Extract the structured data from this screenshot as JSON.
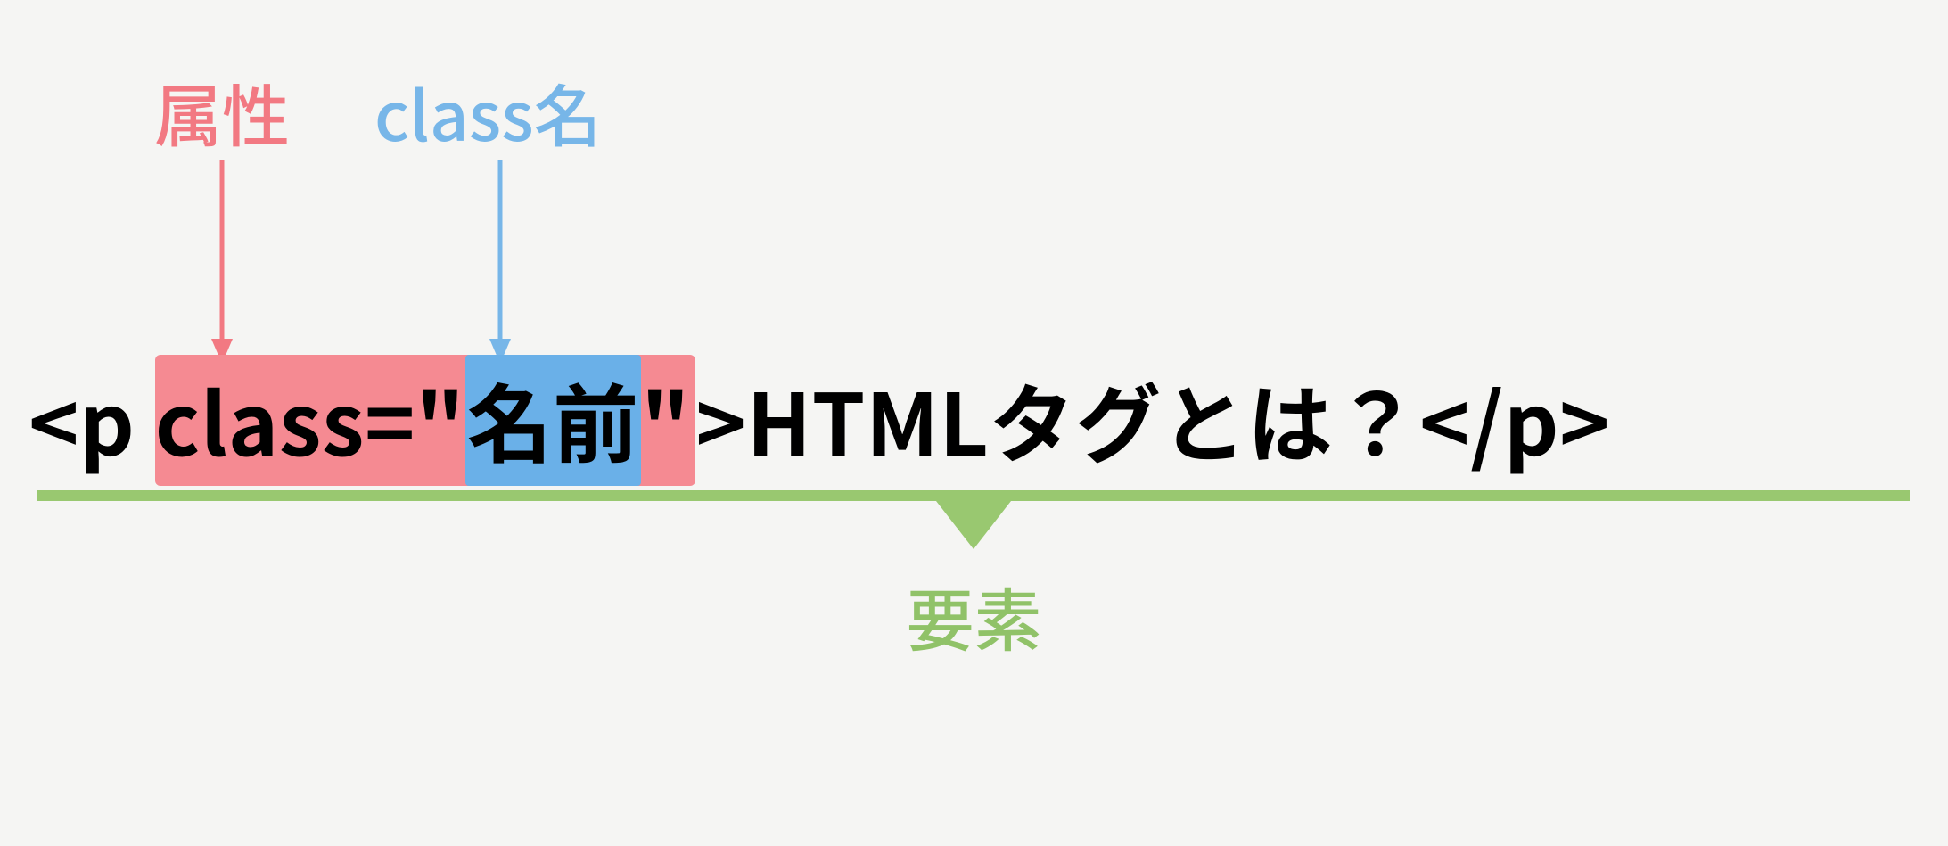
{
  "labels": {
    "attribute": "属性",
    "className": "class名",
    "element": "要素"
  },
  "code": {
    "openStart": "<p ",
    "attrName": "class=",
    "valueOpenQuote": "\"",
    "valueText": "名前",
    "valueCloseQuote": "\"",
    "openEnd": ">",
    "content": "HTMLタグとは？",
    "closeTag": "</p>"
  },
  "colors": {
    "attribute": "#f27982",
    "className": "#77b6e8",
    "element": "#99c870",
    "hlRed": "#f58a92",
    "hlBlue": "#6ab0e8",
    "text": "#000000",
    "bg": "#f5f5f3"
  }
}
